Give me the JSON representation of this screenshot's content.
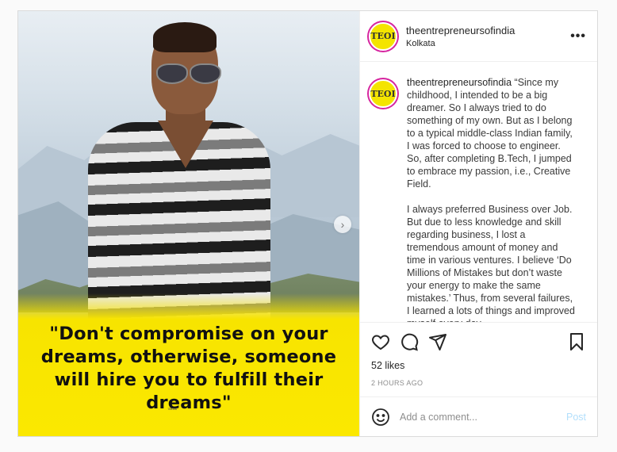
{
  "post": {
    "image": {
      "quote": "\"Don't compromise on your dreams, otherwise, someone will hire you to fulfill their dreams\"",
      "watermark": "TEOI",
      "watermark_sub": "of India",
      "next_icon": "chevron-right-icon"
    },
    "header": {
      "username": "theentrepreneursofindia",
      "location": "Kolkata",
      "avatar_text": "TEOI",
      "more_label": "•••"
    },
    "caption": {
      "username": "theentrepreneursofindia",
      "paragraph1": "“Since my childhood, I intended to be a big dreamer. So I always tried to do something of my own. But as I belong to a typical middle-class Indian family, I was forced to choose to engineer. So, after completing B.Tech, I jumped to embrace my passion, i.e., Creative Field.",
      "paragraph2": "I always preferred Business over Job. But due to less knowledge and skill regarding business, I lost a tremendous amount of money and time in various ventures. I believe ‘Do Millions of Mistakes but don’t waste your energy to make the same mistakes.’ Thus, from several failures, I learned a lots of things and improved myself every day."
    },
    "actions": {
      "icons": [
        "heart-icon",
        "comment-icon",
        "share-icon",
        "bookmark-icon"
      ]
    },
    "likes": "52 likes",
    "timestamp": "2 HOURS AGO",
    "comment_box": {
      "placeholder": "Add a comment...",
      "post_label": "Post",
      "emoji_icon": "smiley-icon"
    }
  }
}
